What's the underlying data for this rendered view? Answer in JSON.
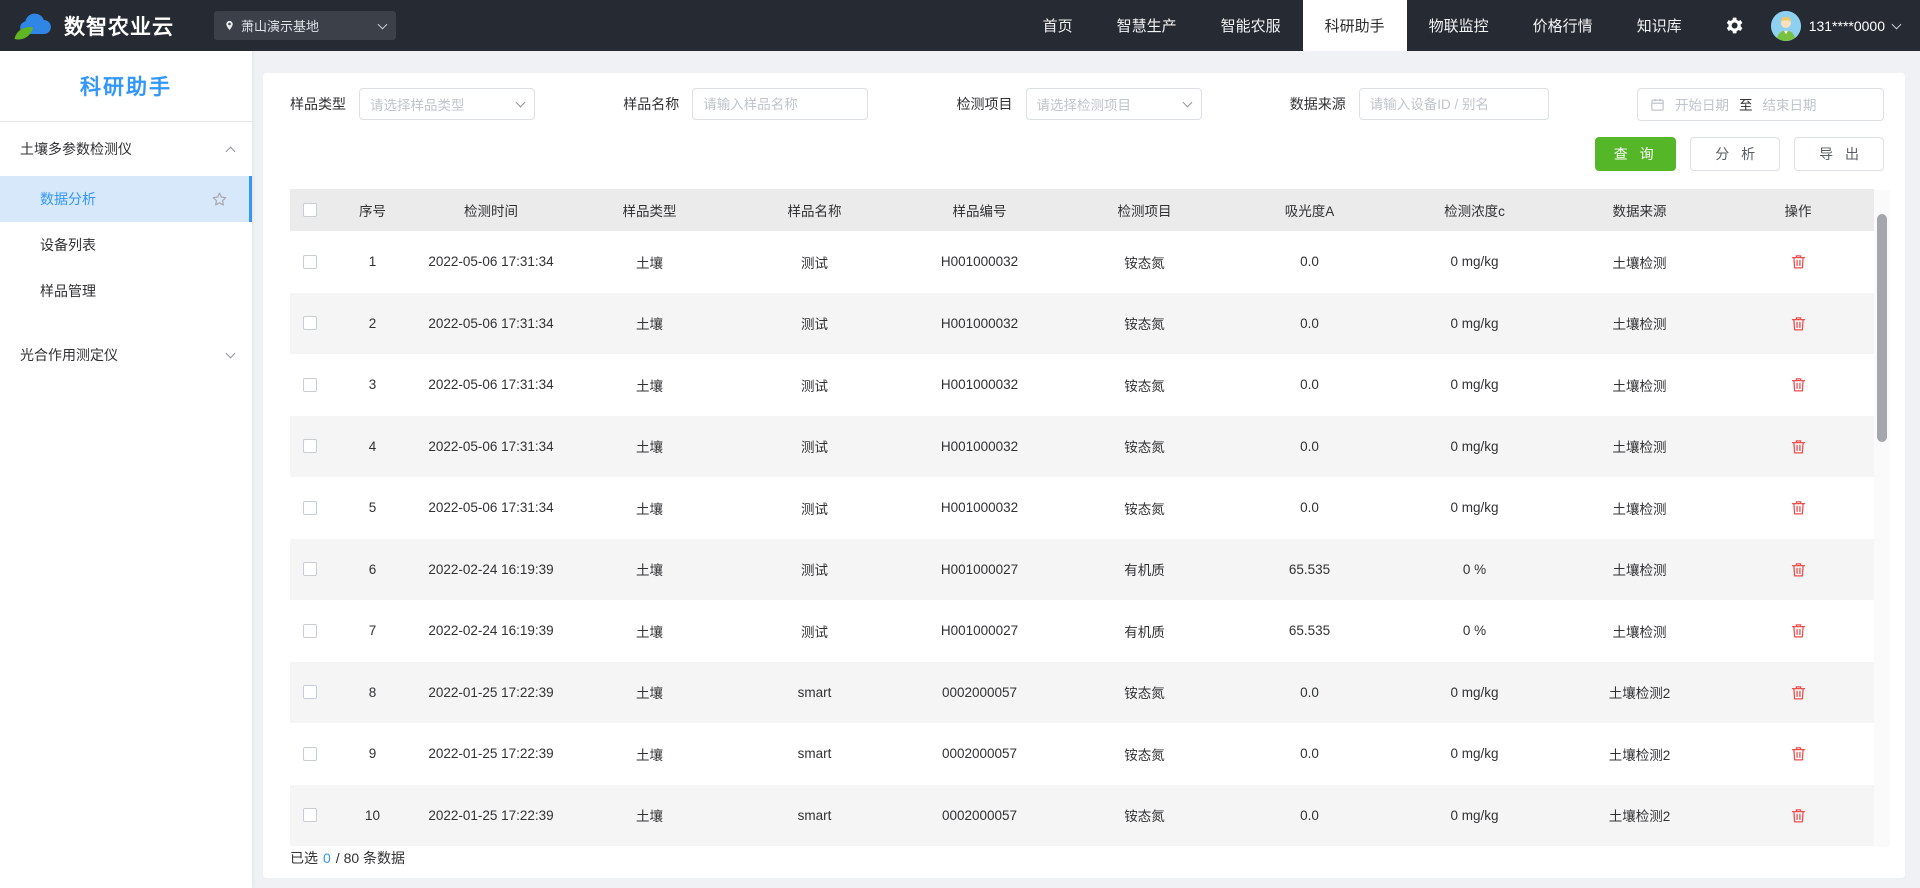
{
  "colors": {
    "navbar_bg": "#262a33",
    "accent_blue": "#3296fa",
    "button_green": "#55b627",
    "danger_red": "#ed4e4e",
    "active_menu_bg": "#d7e8fb"
  },
  "navbar": {
    "brand": "数智农业云",
    "location": "萧山演示基地",
    "items": [
      {
        "label": "首页",
        "active": false
      },
      {
        "label": "智慧生产",
        "active": false
      },
      {
        "label": "智能农服",
        "active": false
      },
      {
        "label": "科研助手",
        "active": true
      },
      {
        "label": "物联监控",
        "active": false
      },
      {
        "label": "价格行情",
        "active": false
      },
      {
        "label": "知识库",
        "active": false
      }
    ],
    "user": "131****0000"
  },
  "sidebar": {
    "title": "科研助手",
    "group1": {
      "label": "土壤多参数检测仪"
    },
    "group1_items": [
      {
        "label": "数据分析",
        "active": true
      },
      {
        "label": "设备列表",
        "active": false
      },
      {
        "label": "样品管理",
        "active": false
      }
    ],
    "group2": {
      "label": "光合作用测定仪"
    }
  },
  "filters": {
    "sample_type": {
      "label": "样品类型",
      "placeholder": "请选择样品类型"
    },
    "sample_name": {
      "label": "样品名称",
      "placeholder": "请输入样品名称"
    },
    "test_item": {
      "label": "检测项目",
      "placeholder": "请选择检测项目"
    },
    "data_source": {
      "label": "数据来源",
      "placeholder": "请输入设备ID / 别名"
    },
    "date_start": "开始日期",
    "date_to": "至",
    "date_end": "结束日期"
  },
  "actions": {
    "query": "查 询",
    "analyze": "分 析",
    "export": "导 出"
  },
  "table": {
    "headers": [
      "序号",
      "检测时间",
      "样品类型",
      "样品名称",
      "样品编号",
      "检测项目",
      "吸光度A",
      "检测浓度c",
      "数据来源",
      "操作"
    ],
    "rows": [
      [
        "1",
        "2022-05-06 17:31:34",
        "土壤",
        "测试",
        "H001000032",
        "铵态氮",
        "0.0",
        "0 mg/kg",
        "土壤检测"
      ],
      [
        "2",
        "2022-05-06 17:31:34",
        "土壤",
        "测试",
        "H001000032",
        "铵态氮",
        "0.0",
        "0 mg/kg",
        "土壤检测"
      ],
      [
        "3",
        "2022-05-06 17:31:34",
        "土壤",
        "测试",
        "H001000032",
        "铵态氮",
        "0.0",
        "0 mg/kg",
        "土壤检测"
      ],
      [
        "4",
        "2022-05-06 17:31:34",
        "土壤",
        "测试",
        "H001000032",
        "铵态氮",
        "0.0",
        "0 mg/kg",
        "土壤检测"
      ],
      [
        "5",
        "2022-05-06 17:31:34",
        "土壤",
        "测试",
        "H001000032",
        "铵态氮",
        "0.0",
        "0 mg/kg",
        "土壤检测"
      ],
      [
        "6",
        "2022-02-24 16:19:39",
        "土壤",
        "测试",
        "H001000027",
        "有机质",
        "65.535",
        "0 %",
        "土壤检测"
      ],
      [
        "7",
        "2022-02-24 16:19:39",
        "土壤",
        "测试",
        "H001000027",
        "有机质",
        "65.535",
        "0 %",
        "土壤检测"
      ],
      [
        "8",
        "2022-01-25 17:22:39",
        "土壤",
        "smart",
        "0002000057",
        "铵态氮",
        "0.0",
        "0 mg/kg",
        "土壤检测2"
      ],
      [
        "9",
        "2022-01-25 17:22:39",
        "土壤",
        "smart",
        "0002000057",
        "铵态氮",
        "0.0",
        "0 mg/kg",
        "土壤检测2"
      ],
      [
        "10",
        "2022-01-25 17:22:39",
        "土壤",
        "smart",
        "0002000057",
        "铵态氮",
        "0.0",
        "0 mg/kg",
        "土壤检测2"
      ]
    ]
  },
  "footer": {
    "prefix": "已选",
    "selected": "0",
    "suffix": "/ 80 条数据"
  }
}
